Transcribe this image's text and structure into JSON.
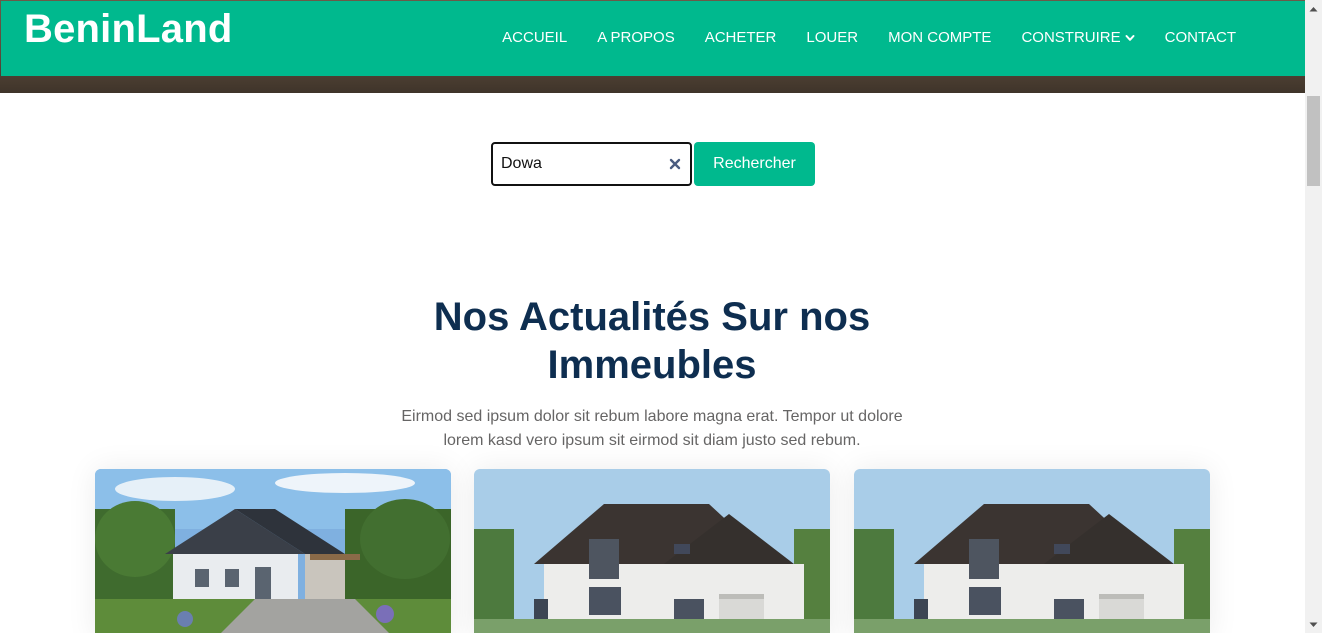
{
  "brand": "BeninLand",
  "nav": {
    "items": [
      "ACCUEIL",
      "A PROPOS",
      "ACHETER",
      "LOUER",
      "MON COMPTE",
      "CONSTRUIRE",
      "CONTACT"
    ]
  },
  "search": {
    "value": "Dowa",
    "button_label": "Rechercher"
  },
  "section": {
    "title": "Nos Actualités Sur nos Immeubles",
    "description": "Eirmod sed ipsum dolor sit rebum labore magna erat. Tempor ut dolore lorem kasd vero ipsum sit eirmod sit diam justo sed rebum."
  },
  "colors": {
    "primary": "#00b98e",
    "heading": "#0e2e50",
    "text": "#666565"
  },
  "icons": {
    "clear": "close-icon",
    "dropdown": "chevron-down-icon"
  }
}
